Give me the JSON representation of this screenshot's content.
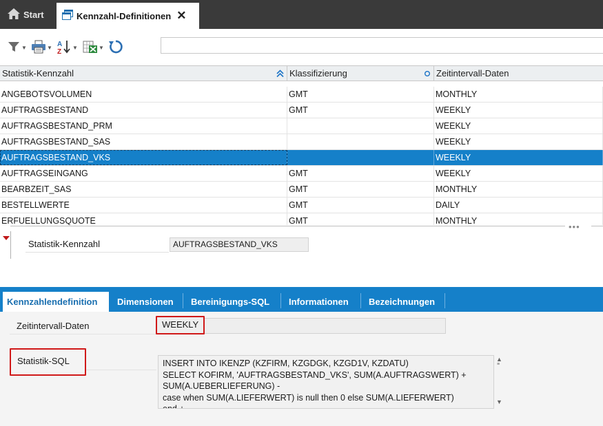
{
  "tabs": {
    "start_label": "Start",
    "active_label": "Kennzahl-Definitionen",
    "close_glyph": "✕"
  },
  "toolbar": {
    "icons": [
      "filter-icon",
      "print-icon",
      "sort-az-icon",
      "export-excel-icon",
      "refresh-icon"
    ],
    "search_value": ""
  },
  "grid": {
    "columns": [
      "Statistik-Kennzahl",
      "Klassifizierung",
      "Zeitintervall-Daten"
    ],
    "rows": [
      {
        "kennzahl": "ANGEBOTSVOLUMEN",
        "klass": "GMT",
        "intervall": "MONTHLY"
      },
      {
        "kennzahl": "AUFTRAGSBESTAND",
        "klass": "GMT",
        "intervall": "WEEKLY"
      },
      {
        "kennzahl": "AUFTRAGSBESTAND_PRM",
        "klass": "",
        "intervall": "WEEKLY"
      },
      {
        "kennzahl": "AUFTRAGSBESTAND_SAS",
        "klass": "",
        "intervall": "WEEKLY"
      },
      {
        "kennzahl": "AUFTRAGSBESTAND_VKS",
        "klass": "",
        "intervall": "WEEKLY"
      },
      {
        "kennzahl": "AUFTRAGSEINGANG",
        "klass": "GMT",
        "intervall": "WEEKLY"
      },
      {
        "kennzahl": "BEARBZEIT_SAS",
        "klass": "GMT",
        "intervall": "MONTHLY"
      },
      {
        "kennzahl": "BESTELLWERTE",
        "klass": "GMT",
        "intervall": "DAILY"
      },
      {
        "kennzahl": "ERFUELLUNGSQUOTE",
        "klass": "GMT",
        "intervall": "MONTHLY"
      }
    ],
    "selected_index": 4
  },
  "splitter": {
    "dots": "•••"
  },
  "detail": {
    "label": "Statistik-Kennzahl",
    "value": "AUFTRAGSBESTAND_VKS"
  },
  "detail_tabs": [
    "Kennzahlendefinition",
    "Dimensionen",
    "Bereinigungs-SQL",
    "Informationen",
    "Bezeichnungen"
  ],
  "form": {
    "zeitintervall_label": "Zeitintervall-Daten",
    "zeitintervall_value": "WEEKLY",
    "sql_label": "Statistik-SQL",
    "sql_value": "INSERT INTO IKENZP (KZFIRM, KZGDGK, KZGD1V, KZDATU)\nSELECT KOFIRM, 'AUFTRAGSBESTAND_VKS', SUM(A.AUFTRAGSWERT) +\nSUM(A.UEBERLIEFERUNG) -\ncase when SUM(A.LIEFERWERT) is null then 0 else SUM(A.LIEFERWERT)\nend +"
  },
  "colors": {
    "tabbar_bg": "#3a3a3a",
    "accent_blue": "#1580c9",
    "highlight_red": "#d01818"
  }
}
